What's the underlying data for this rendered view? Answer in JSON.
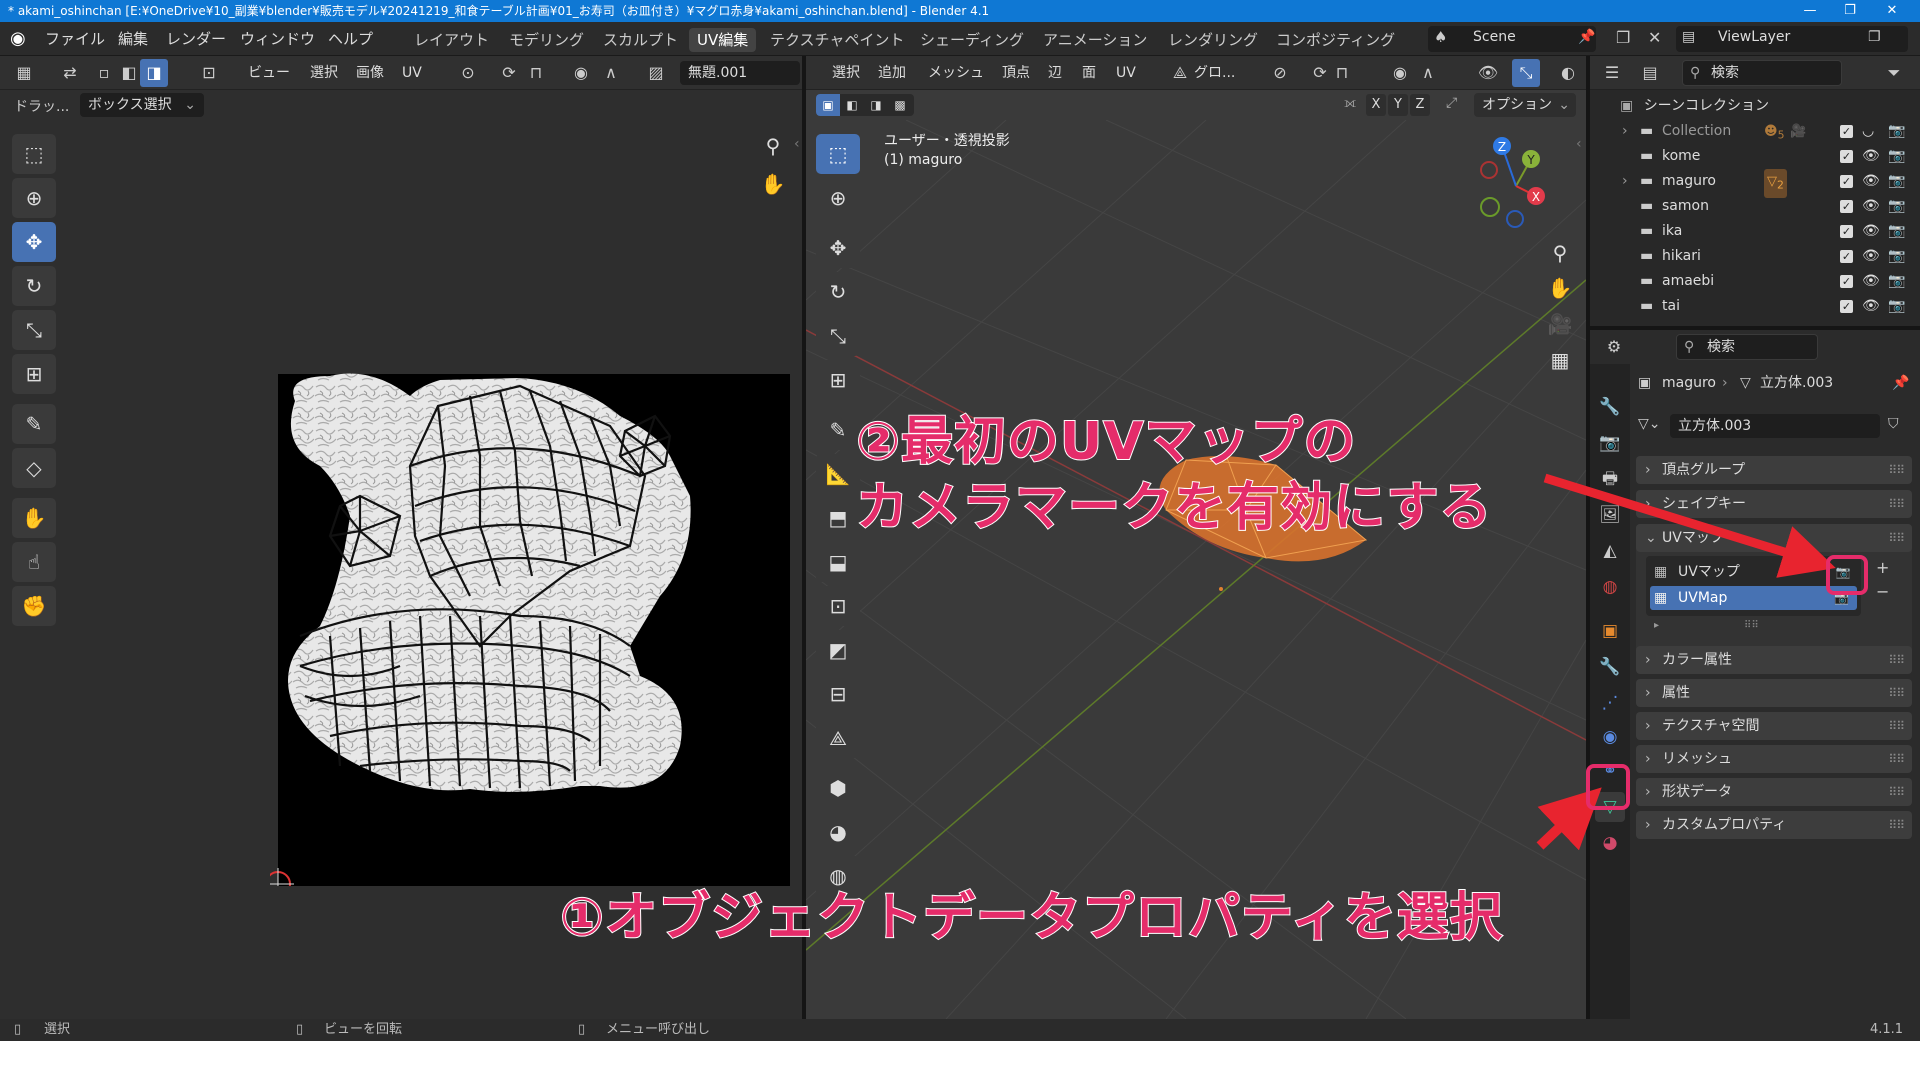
{
  "titlebar": {
    "text": "* akami_oshinchan [E:¥OneDrive¥10_副業¥blender¥販売モデル¥20241219_和食テーブル計画¥01_お寿司（お皿付き）¥マグロ赤身¥akami_oshinchan.blend] - Blender 4.1",
    "minimize": "—",
    "restore": "❐",
    "close": "✕"
  },
  "menu": [
    "ファイル",
    "編集",
    "レンダー",
    "ウィンドウ",
    "ヘルプ"
  ],
  "workspaces": [
    "レイアウト",
    "モデリング",
    "スカルプト",
    "UV編集",
    "テクスチャペイント",
    "シェーディング",
    "アニメーション",
    "レンダリング",
    "コンポジティング"
  ],
  "scene": {
    "label": "Scene",
    "viewlayer": "ViewLayer"
  },
  "uv_editor": {
    "header_menus": [
      "ビュー",
      "選択",
      "画像",
      "UV"
    ],
    "image_name": "無題.001",
    "tool_hint_label": "ドラッ...",
    "box_select": "ボックス選択"
  },
  "viewport": {
    "header_menus": [
      "選択",
      "追加",
      "メッシュ",
      "頂点",
      "辺",
      "面",
      "UV"
    ],
    "transform_orientation": "グロ...",
    "axis_x": "X",
    "axis_y": "Y",
    "axis_z": "Z",
    "options": "オプション",
    "view_name": "ユーザー・透視投影",
    "object_name": "(1) maguro",
    "gizmo": {
      "x": "X",
      "y": "Y",
      "z": "Z"
    }
  },
  "outliner": {
    "search_placeholder": "検索",
    "root": "シーンコレクション",
    "items": [
      "Collection",
      "kome",
      "maguro",
      "samon",
      "ika",
      "hikari",
      "amaebi",
      "tai"
    ],
    "badge_collection": "5",
    "badge_maguro": "2"
  },
  "properties": {
    "search_placeholder": "検索",
    "breadcrumb_object": "maguro",
    "breadcrumb_mesh": "立方体.003",
    "mesh_name": "立方体.003",
    "panels_top": [
      "頂点グループ",
      "シェイプキー"
    ],
    "uv_panel": "UVマップ",
    "uv_maps": [
      "UVマップ",
      "UVMap"
    ],
    "panels_bottom": [
      "カラー属性",
      "属性",
      "テクスチャ空間",
      "リメッシュ",
      "形状データ",
      "カスタムプロパティ"
    ]
  },
  "statusbar": {
    "select": "選択",
    "rotate": "ビューを回転",
    "menu": "メニュー呼び出し",
    "version": "4.1.1"
  },
  "annotations": {
    "step2_line1": "②最初のUVマップの",
    "step2_line2": "カメラマークを有効にする",
    "step1": "①オブジェクトデータプロパティを選択"
  },
  "colors": {
    "accent": "#4772b3",
    "annotation": "#e52c6a",
    "titlebar": "#0f78d4"
  }
}
